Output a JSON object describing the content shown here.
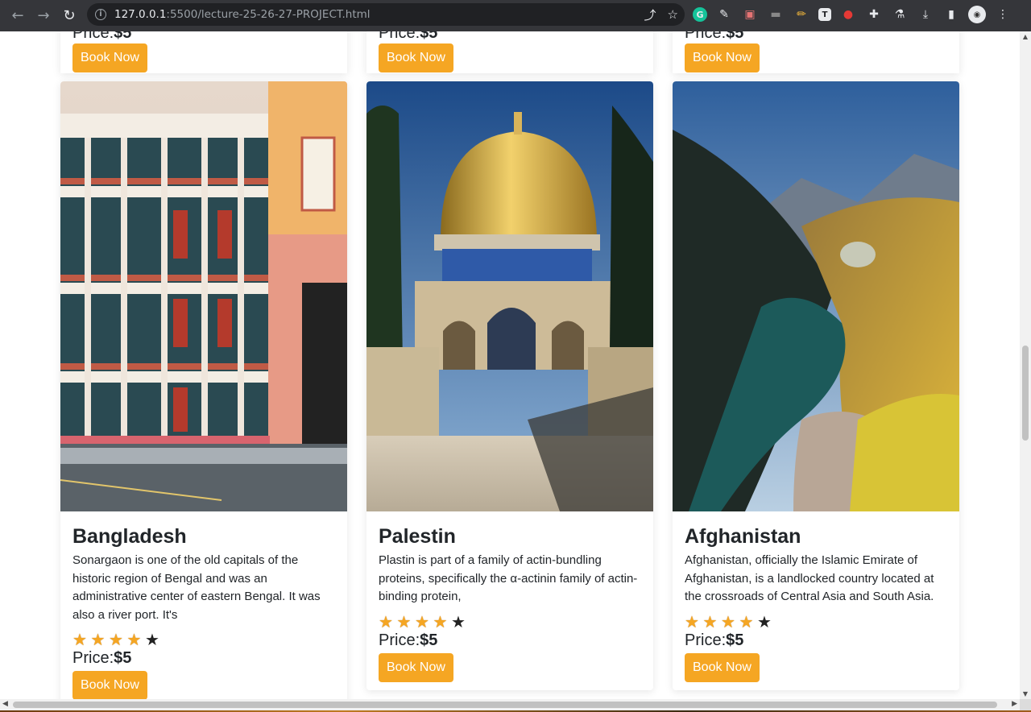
{
  "browser": {
    "url_host": "127.0.0.1",
    "url_rest": ":5500/lecture-25-26-27-PROJECT.html"
  },
  "top_row": [
    {
      "price_label": "Price:",
      "price_value": "$5",
      "button": "Book Now"
    },
    {
      "price_label": "Price:",
      "price_value": "$5",
      "button": "Book Now"
    },
    {
      "price_label": "Price:",
      "price_value": "$5",
      "button": "Book Now"
    }
  ],
  "cards": [
    {
      "title": "Bangladesh",
      "text": "Sonargaon is one of the old capitals of the historic region of Bengal and was an administrative center of eastern Bengal. It was also a river port. It's",
      "rating": 4,
      "price_label": "Price:",
      "price_value": "$5",
      "button": "Book Now"
    },
    {
      "title": "Palestin",
      "text": "Plastin is part of a family of actin-bundling proteins, specifically the α-actinin family of actin-binding protein,",
      "rating": 4,
      "price_label": "Price:",
      "price_value": "$5",
      "button": "Book Now"
    },
    {
      "title": "Afghanistan",
      "text": "Afghanistan, officially the Islamic Emirate of Afghanistan, is a landlocked country located at the crossroads of Central Asia and South Asia.",
      "rating": 4,
      "price_label": "Price:",
      "price_value": "$5",
      "button": "Book Now"
    }
  ],
  "colors": {
    "accent": "#f5a623",
    "chrome": "#35363a"
  }
}
